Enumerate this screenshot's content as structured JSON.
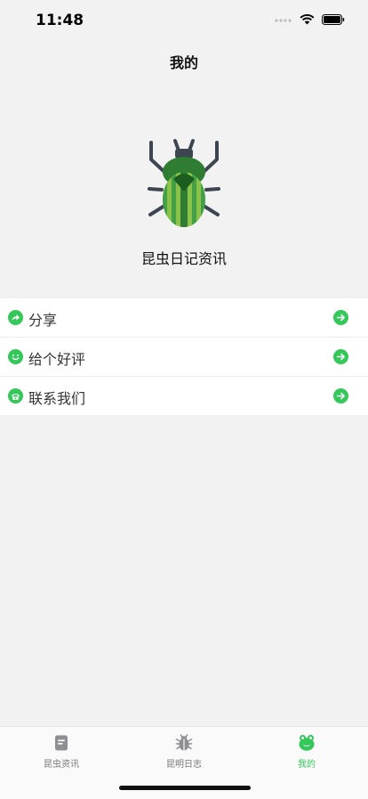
{
  "status_bar": {
    "time": "11:48"
  },
  "header": {
    "title": "我的"
  },
  "profile": {
    "app_name": "昆虫日记资讯"
  },
  "menu": {
    "items": [
      {
        "label": "分享",
        "icon": "share-icon"
      },
      {
        "label": "给个好评",
        "icon": "smile-icon"
      },
      {
        "label": "联系我们",
        "icon": "phone-icon"
      }
    ]
  },
  "tabbar": {
    "tabs": [
      {
        "label": "昆虫资讯",
        "icon": "document-icon",
        "active": false
      },
      {
        "label": "昆明日志",
        "icon": "bug-icon",
        "active": false
      },
      {
        "label": "我的",
        "icon": "frog-icon",
        "active": true
      }
    ]
  },
  "colors": {
    "accent": "#34c759",
    "background": "#f2f2f2",
    "tab_inactive": "#777777"
  }
}
